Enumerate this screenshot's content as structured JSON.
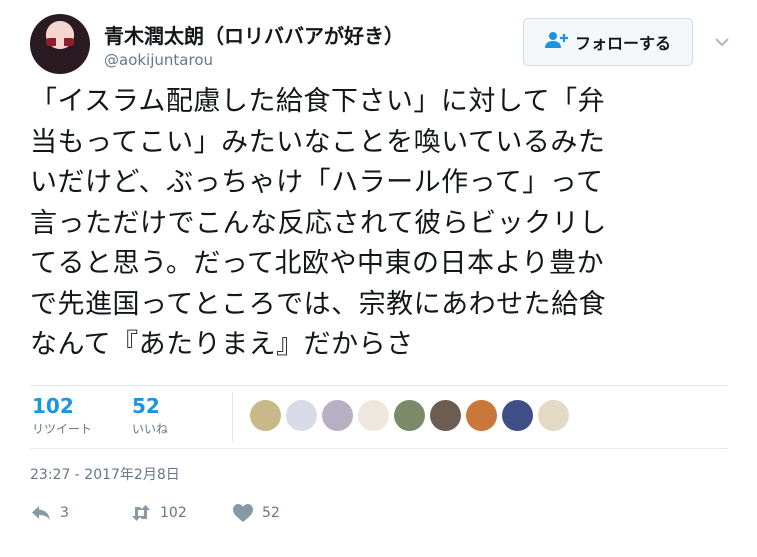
{
  "user": {
    "display_name": "青木潤太朗（ロリババアが好き）",
    "handle": "@aokijuntarou"
  },
  "follow_button": {
    "label": "フォローする"
  },
  "tweet": {
    "lines": [
      "「イスラム配慮した給食下さい」に対して「弁",
      "当もってこい」みたいなことを喚いているみた",
      "いだけど、ぶっちゃけ「ハラール作って」って",
      "言っただけでこんな反応されて彼らビックリし",
      "てると思う。だって北欧や中東の日本より豊か",
      "で先進国ってところでは、宗教にあわせた給食",
      "なんて『あたりまえ』だからさ"
    ],
    "timestamp": "23:27 - 2017年2月8日"
  },
  "stats": {
    "retweets": {
      "value": "102",
      "label": "リツイート"
    },
    "likes": {
      "value": "52",
      "label": "いいね"
    }
  },
  "likers_colors": [
    "#c9b98a",
    "#d8dbe6",
    "#b6b0c2",
    "#efe7dc",
    "#7d8a6a",
    "#6b5d52",
    "#c7783a",
    "#3d4f86",
    "#e4d9c4"
  ],
  "actions": {
    "reply_count": "3",
    "retweet_count": "102",
    "like_count": "52"
  },
  "colors": {
    "accent": "#1b95e0",
    "muted": "#657786"
  }
}
